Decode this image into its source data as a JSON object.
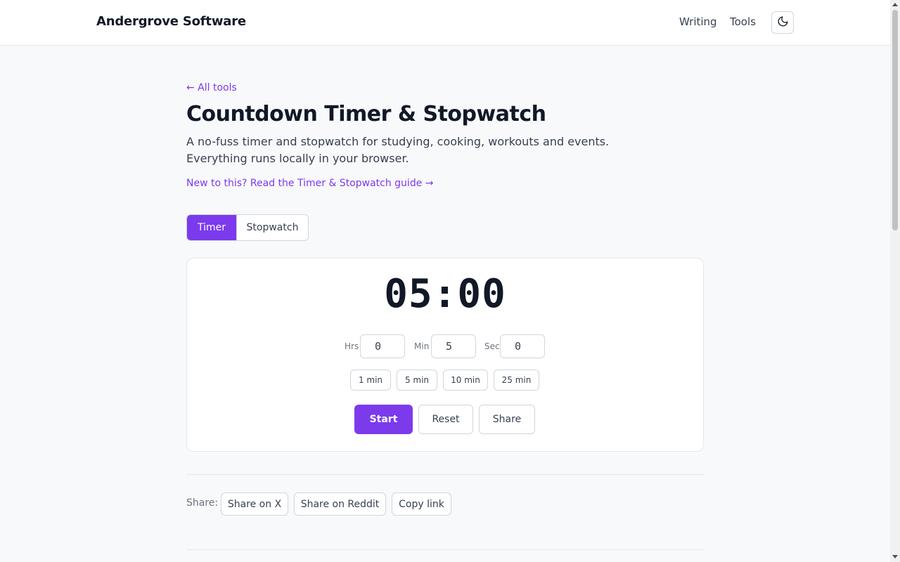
{
  "header": {
    "brand": "Andergrove Software",
    "nav": [
      {
        "label": "Writing"
      },
      {
        "label": "Tools"
      }
    ],
    "theme_toggle_icon": "moon-icon"
  },
  "page": {
    "back_link": "← All tools",
    "title": "Countdown Timer & Stopwatch",
    "description": "A no-fuss timer and stopwatch for studying, cooking, workouts and events. Everything runs locally in your browser.",
    "guide_link": "New to this? Read the Timer & Stopwatch guide →"
  },
  "mode_tabs": [
    {
      "label": "Timer",
      "active": true
    },
    {
      "label": "Stopwatch",
      "active": false
    }
  ],
  "timer": {
    "display": "05:00",
    "fields": {
      "hours": {
        "label": "Hrs",
        "value": "0"
      },
      "minutes": {
        "label": "Min",
        "value": "5"
      },
      "seconds": {
        "label": "Sec",
        "value": "0"
      }
    },
    "presets": [
      "1 min",
      "5 min",
      "10 min",
      "25 min"
    ],
    "actions": {
      "start": "Start",
      "reset": "Reset",
      "share": "Share"
    }
  },
  "share_bar": {
    "label": "Share:",
    "buttons": [
      "Share on X",
      "Share on Reddit",
      "Copy link"
    ]
  },
  "colors": {
    "accent": "#7c3aed",
    "text": "#111827",
    "muted": "#6b7280",
    "border": "#d1d5db",
    "background": "#f8f9fb"
  }
}
